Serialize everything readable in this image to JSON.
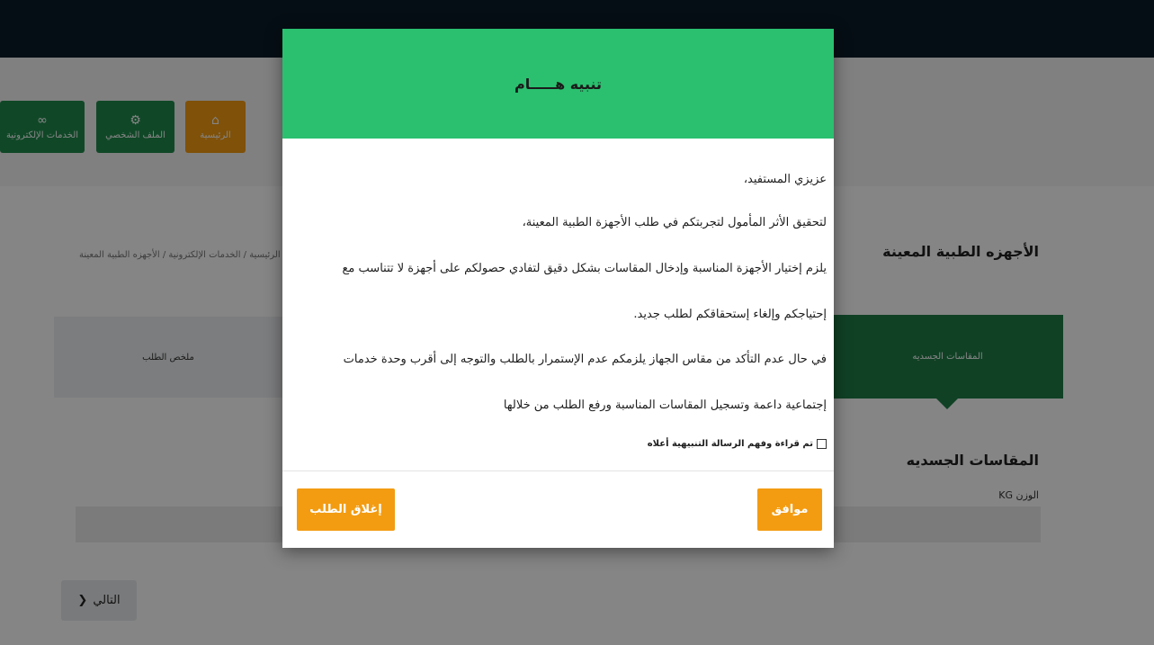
{
  "nav": {
    "home_label": "الرئيسية",
    "home_icon": "home-icon",
    "profile_label": "الملف الشخصي",
    "profile_icon": "gear-icon",
    "services_label": "الخدمات الإلكترونية",
    "services_icon": "link-icon"
  },
  "page": {
    "title": "الأجهزه الطبية المعينة",
    "breadcrumb": "الرئيسية / الخدمات الإلكترونية / الأجهزه الطبية المعينة",
    "step_active": "المقاسات الجسديه",
    "step_summary": "ملخص الطلب",
    "section_title": "المقاسات الجسديه",
    "weight_label": "الوزن KG",
    "next_label": "التالي",
    "next_icon": "chevron-left-icon"
  },
  "modal": {
    "title": "تنبيه هـــــام",
    "lines": [
      "عزيزي المستفيد،",
      "لتحقيق الأثر المأمول لتجربتكم في طلب الأجهزة الطبية المعينة،",
      "يلزم إختيار الأجهزة المناسبة وإدخال المقاسات بشكل دقيق لتفادي حصولكم على أجهزة لا تتناسب مع",
      "إحتياجكم وإلغاء إستحقاقكم لطلب جديد.",
      "في حال عدم التأكد من مقاس الجهاز يلزمكم عدم الإستمرار بالطلب والتوجه إلى أقرب وحدة خدمات",
      "إجتماعية داعمة وتسجيل المقاسات المناسبة ورفع الطلب من خلالها"
    ],
    "checkbox_label": "تم قراءة وفهم الرسالة التنبيهية أعلاه",
    "ok_label": "موافق",
    "close_label": "إغلاق الطلب"
  },
  "colors": {
    "header_green": "#2ac06f",
    "tile_green": "#1f8a4c",
    "accent_orange": "#f39c12",
    "topbar": "#0c1b29"
  }
}
